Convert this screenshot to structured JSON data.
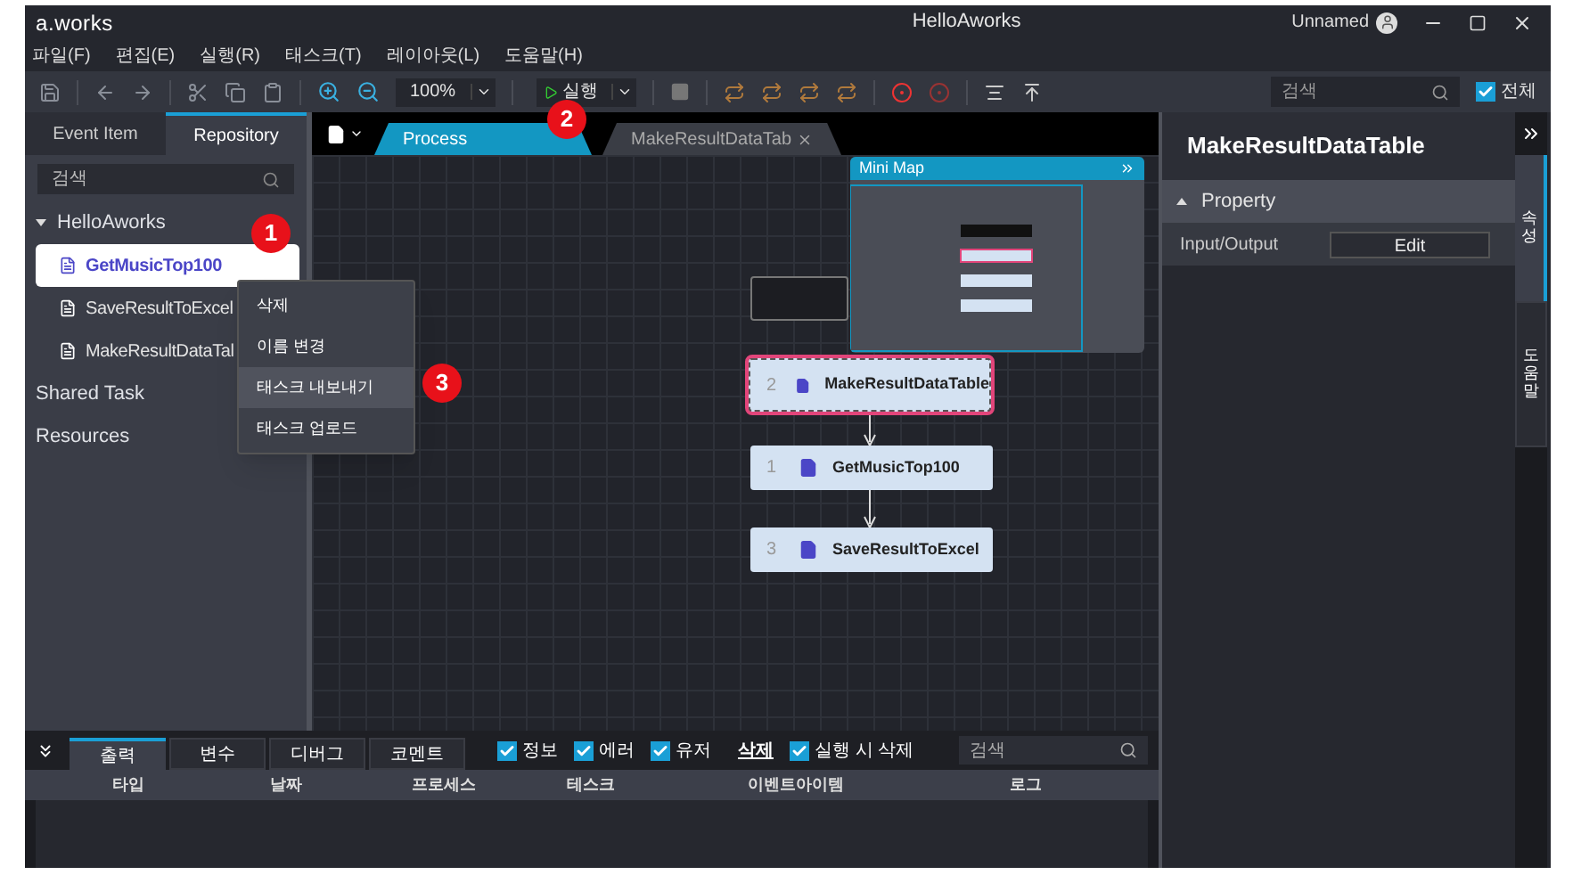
{
  "window": {
    "logo": "a.works",
    "title": "HelloAworks",
    "user": "Unnamed"
  },
  "menu": [
    "파일(F)",
    "편집(E)",
    "실행(R)",
    "태스크(T)",
    "레이아웃(L)",
    "도움말(H)"
  ],
  "toolbar": {
    "zoom": "100%",
    "run": "실행",
    "search_placeholder": "검색",
    "all_checkbox": {
      "label": "전체",
      "checked": true
    }
  },
  "left_panel": {
    "tabs": [
      {
        "label": "Event Item",
        "selected": false
      },
      {
        "label": "Repository",
        "selected": true
      }
    ],
    "search_placeholder": "검색",
    "tree": [
      {
        "label": "HelloAworks",
        "expanded": true,
        "children": [
          {
            "label": "GetMusicTop100",
            "selected": true
          },
          {
            "label": "SaveResultToExcel",
            "selected": false
          },
          {
            "label": "MakeResultDataTal",
            "selected": false
          }
        ]
      },
      {
        "label": "Shared Task"
      },
      {
        "label": "Resources"
      }
    ]
  },
  "context_menu": [
    {
      "label": "삭제",
      "selected": false
    },
    {
      "label": "이름 변경",
      "selected": false
    },
    {
      "label": "태스크 내보내기",
      "selected": true
    },
    {
      "label": "태스크 업로드",
      "selected": false
    }
  ],
  "doc_tabs": [
    {
      "label": "Process",
      "selected": true,
      "closable": false
    },
    {
      "label": "MakeResultDataTab",
      "selected": false,
      "closable": true
    }
  ],
  "canvas": {
    "nodes": [
      {
        "number": "2",
        "label": "MakeResultDataTable",
        "selected": true
      },
      {
        "number": "1",
        "label": "GetMusicTop100",
        "selected": false
      },
      {
        "number": "3",
        "label": "SaveResultToExcel",
        "selected": false
      }
    ],
    "minimap": {
      "title": "Mini Map"
    }
  },
  "callouts": [
    "1",
    "2",
    "3"
  ],
  "properties": {
    "title": "MakeResultDataTable",
    "section": "Property",
    "rows": [
      {
        "label": "Input/Output",
        "button": "Edit"
      }
    ]
  },
  "side_tabs": [
    {
      "label": "속성",
      "selected": true
    },
    {
      "label": "도움말",
      "selected": false
    }
  ],
  "output_panel": {
    "tabs": [
      {
        "label": "출력",
        "selected": true
      },
      {
        "label": "변수",
        "selected": false
      },
      {
        "label": "디버그",
        "selected": false
      },
      {
        "label": "코멘트",
        "selected": false
      }
    ],
    "filters": [
      {
        "label": "정보",
        "checked": true
      },
      {
        "label": "에러",
        "checked": true
      },
      {
        "label": "유저",
        "checked": true
      }
    ],
    "clear": "삭제",
    "clear_on_run": {
      "label": "실행 시 삭제",
      "checked": true
    },
    "search_placeholder": "검색",
    "columns": [
      "타입",
      "날짜",
      "프로세스",
      "테스크",
      "이벤트아이템",
      "로그"
    ]
  }
}
